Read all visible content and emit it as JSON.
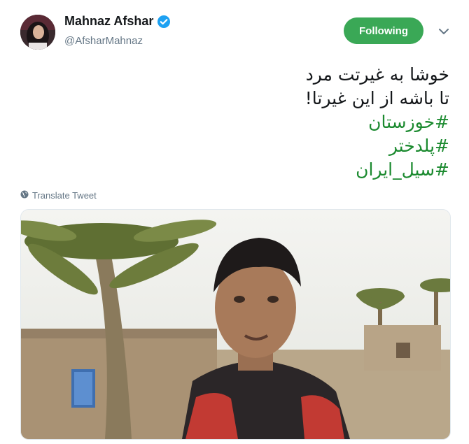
{
  "user": {
    "name": "Mahnaz Afshar",
    "handle": "@AfsharMahnaz",
    "verified": true
  },
  "follow_button": {
    "label": "Following",
    "color": "#3aa856"
  },
  "tweet": {
    "lines": [
      "خوشا به غیرتت مرد",
      "تا باشه از این غیرتا!"
    ],
    "hashtags": [
      "#خوزستان",
      "#پلدختر",
      "#سیل_ایران"
    ],
    "hashtag_color": "#1b8a2f"
  },
  "translate_label": "Translate Tweet",
  "icons": {
    "verified": "verified-badge-icon",
    "more": "chevron-down-icon",
    "translate": "globe-icon"
  }
}
